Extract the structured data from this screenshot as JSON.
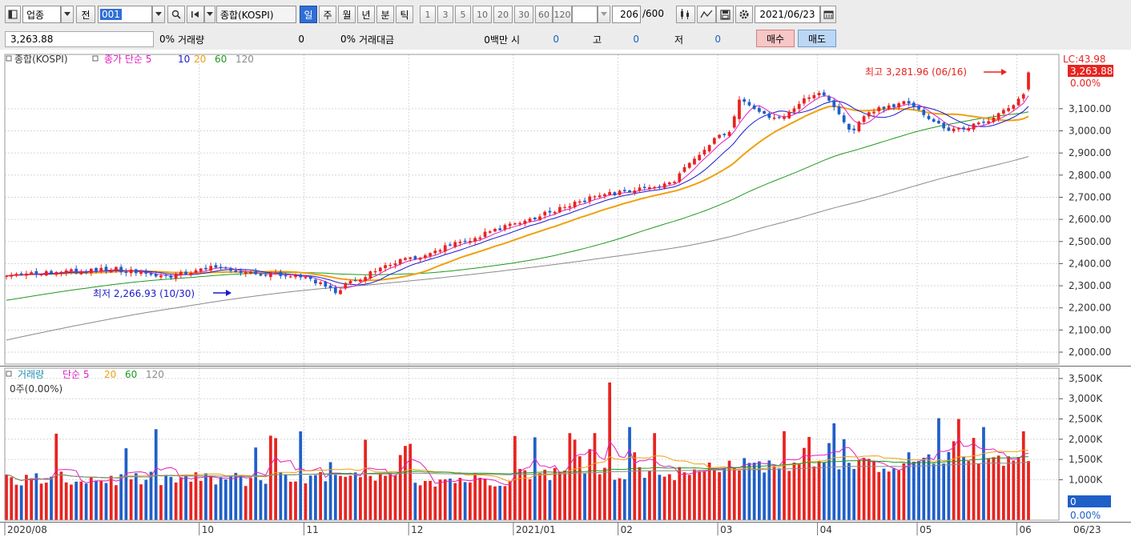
{
  "toolbar": {
    "market_type": "업종",
    "prefix_btn": "전",
    "code_value": "001",
    "index_name": "종합(KOSPI)",
    "periods": [
      "일",
      "주",
      "월",
      "년",
      "분",
      "틱"
    ],
    "active_period": "일",
    "minute_options": [
      "1",
      "3",
      "5",
      "10",
      "20",
      "30",
      "60",
      "120"
    ],
    "count_value": "206",
    "count_total": "/600",
    "date_value": "2021/06/23"
  },
  "infobar": {
    "price": "3,263.88",
    "change_pct": "0%",
    "volume_label": "거래량",
    "volume_value": "0",
    "volume_pct": "0%",
    "amount_label": "거래대금",
    "amount_value": "0백만",
    "open_label": "시",
    "open_value": "0",
    "high_label": "고",
    "high_value": "0",
    "low_label": "저",
    "low_value": "0",
    "buy_label": "매수",
    "sell_label": "매도"
  },
  "price_legend": {
    "title": "종합(KOSPI)",
    "ma_label": "종가 단순 5",
    "ma_periods": [
      "10",
      "20",
      "60",
      "120"
    ]
  },
  "volume_legend": {
    "title": "거래량",
    "ma_label": "단순 5",
    "ma_periods": [
      "20",
      "60",
      "120"
    ],
    "current": "0주(0.00%)"
  },
  "annotations": {
    "high": "최고 3,281.96 (06/16)",
    "low": "최저 2,266.93 (10/30)",
    "lc": "LC:43.98",
    "last": "3,263.88",
    "last_pct": "0.00%"
  },
  "price_axis": [
    "3,100.00",
    "3,000.00",
    "2,900.00",
    "2,800.00",
    "2,700.00",
    "2,600.00",
    "2,500.00",
    "2,400.00",
    "2,300.00",
    "2,200.00",
    "2,100.00",
    "2,000.00"
  ],
  "volume_axis": [
    "3,500K",
    "3,000K",
    "2,500K",
    "2,000K",
    "1,500K",
    "1,000K",
    "0.00%"
  ],
  "volume_last": "0",
  "date_axis": [
    "2020/08",
    "10",
    "11",
    "12",
    "2021/01",
    "02",
    "03",
    "04",
    "05",
    "06",
    "06/23"
  ],
  "colors": {
    "up": "#e8231f",
    "down": "#1f5fc8",
    "ma5": "#e020c0",
    "ma10": "#1a1acb",
    "ma20": "#f0a010",
    "ma60": "#1e9a1e",
    "ma120": "#8a8a8a"
  },
  "chart_data": {
    "type": "candlestick",
    "title": "종합(KOSPI)",
    "period": "daily",
    "date_range": [
      "2020/08",
      "2021/06/23"
    ],
    "price_range": [
      1950,
      3320
    ],
    "control_points": [
      {
        "date": "2020/08",
        "close": 2350
      },
      {
        "date": "2020/09",
        "close": 2330
      },
      {
        "date": "2020/10",
        "close": 2350
      },
      {
        "date": "2020/10/30",
        "close": 2267
      },
      {
        "date": "2020/11",
        "close": 2450
      },
      {
        "date": "2020/12",
        "close": 2720
      },
      {
        "date": "2021/01",
        "close": 3130
      },
      {
        "date": "2021/02",
        "close": 3080
      },
      {
        "date": "2021/03",
        "close": 3000
      },
      {
        "date": "2021/04",
        "close": 3170
      },
      {
        "date": "2021/05",
        "close": 3140
      },
      {
        "date": "2021/06/16",
        "close": 3278
      },
      {
        "date": "2021/06/23",
        "close": 3264
      }
    ],
    "moving_averages": [
      "5",
      "10",
      "20",
      "60",
      "120"
    ],
    "last_close": 3263.88,
    "high": {
      "value": 3281.96,
      "date": "06/16"
    },
    "low": {
      "value": 2266.93,
      "date": "10/30"
    },
    "volume_range_k": [
      0,
      3700
    ],
    "volume_peak_k": 3400
  }
}
